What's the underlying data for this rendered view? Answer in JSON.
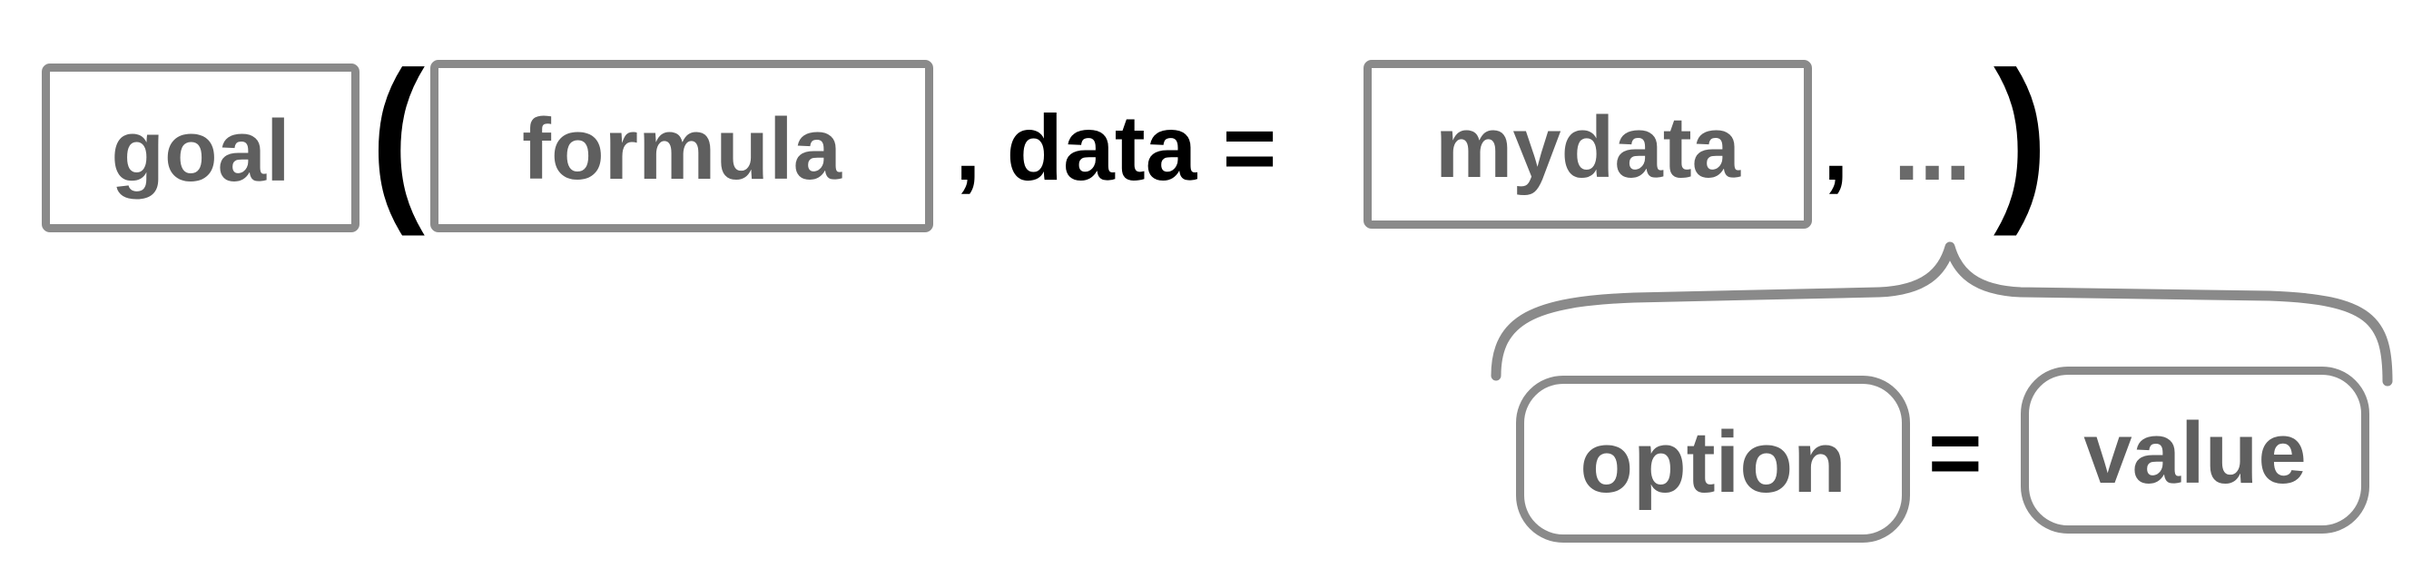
{
  "syntax": {
    "goal": "goal",
    "open_paren": "(",
    "formula": "formula",
    "comma_data": ", data =",
    "mydata": "mydata",
    "comma": ",",
    "ellipsis": "...",
    "close_paren": ")"
  },
  "options": {
    "option": "option",
    "equals": "=",
    "value": "value"
  },
  "colors": {
    "box_border": "#8a8a8a",
    "box_text": "#5f5f5f",
    "operator_text": "#000000",
    "ellipsis_text": "#6a6a6a"
  }
}
